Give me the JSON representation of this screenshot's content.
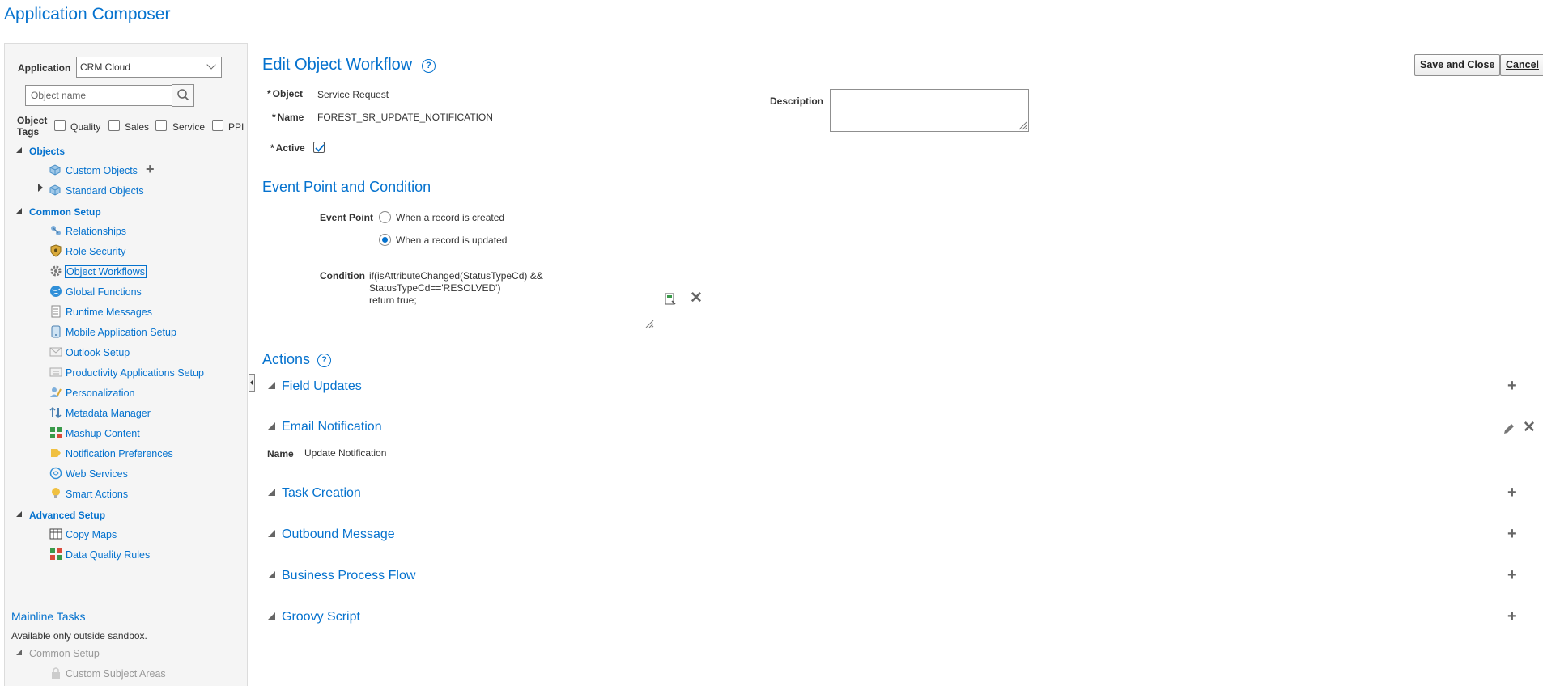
{
  "app_title": "Application Composer",
  "sidebar": {
    "application_label": "Application",
    "application_value": "CRM Cloud",
    "search_placeholder": "Object name",
    "object_tags_label_1": "Object",
    "object_tags_label_2": "Tags",
    "tags": [
      "Quality",
      "Sales",
      "Service",
      "PPI"
    ],
    "objects_header": "Objects",
    "custom_objects": "Custom Objects",
    "standard_objects": "Standard Objects",
    "common_setup_header": "Common Setup",
    "common_items": [
      "Relationships",
      "Role Security",
      "Object Workflows",
      "Global Functions",
      "Runtime Messages",
      "Mobile Application Setup",
      "Outlook Setup",
      "Productivity Applications Setup",
      "Personalization",
      "Metadata Manager",
      "Mashup Content",
      "Notification Preferences",
      "Web Services",
      "Smart Actions"
    ],
    "advanced_setup_header": "Advanced Setup",
    "advanced_items": [
      "Copy Maps",
      "Data Quality Rules"
    ],
    "mainline_title": "Mainline Tasks",
    "mainline_note": "Available only outside sandbox.",
    "mainline_common_setup": "Common Setup",
    "mainline_item": "Custom Subject Areas"
  },
  "main": {
    "title": "Edit Object Workflow",
    "help_glyph": "?",
    "save_close_label": "Save and Close",
    "cancel_label": "Cancel",
    "object_label": "Object",
    "object_value": "Service Request",
    "name_label": "Name",
    "name_value": "FOREST_SR_UPDATE_NOTIFICATION",
    "active_label": "Active",
    "description_label": "Description",
    "event_section_title": "Event Point and Condition",
    "event_point_label": "Event Point",
    "event_option_created": "When a record is created",
    "event_option_updated": "When a record is updated",
    "condition_label": "Condition",
    "condition_lines": [
      "if(isAttributeChanged(StatusTypeCd) &&",
      "StatusTypeCd=='RESOLVED')",
      "return true;"
    ],
    "actions_title": "Actions",
    "actions": {
      "field_updates": "Field Updates",
      "email_notification": "Email Notification",
      "email_name_label": "Name",
      "email_name_value": "Update Notification",
      "task_creation": "Task Creation",
      "outbound_message": "Outbound Message",
      "business_process_flow": "Business Process Flow",
      "groovy_script": "Groovy Script"
    }
  },
  "colors": {
    "link_blue": "#0572ce",
    "sidebar_bg": "#f5f5f5"
  }
}
